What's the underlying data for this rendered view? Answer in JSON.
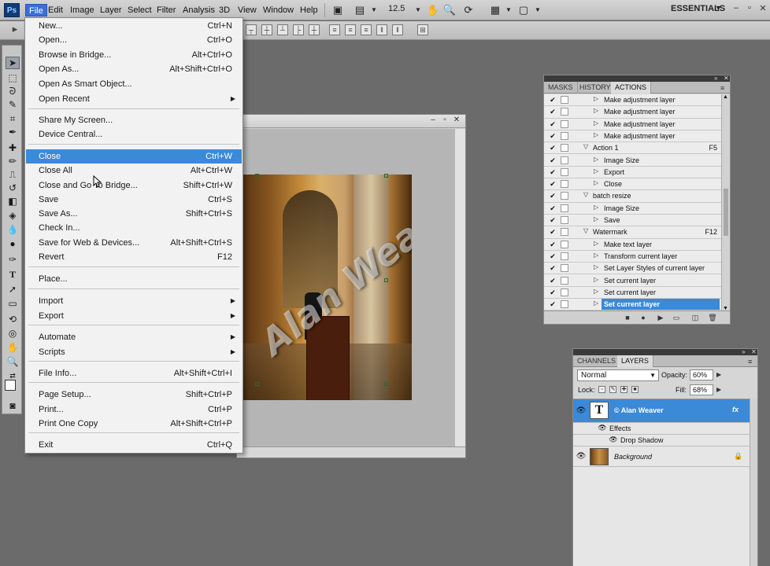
{
  "menubar": {
    "logo": "Ps",
    "items": [
      "File",
      "Edit",
      "Image",
      "Layer",
      "Select",
      "Filter",
      "Analysis",
      "3D",
      "View",
      "Window",
      "Help"
    ],
    "zoom": "12.5",
    "workspace": "ESSENTIALS"
  },
  "file_menu": {
    "items": [
      {
        "label": "New...",
        "shortcut": "Ctrl+N"
      },
      {
        "label": "Open...",
        "shortcut": "Ctrl+O"
      },
      {
        "label": "Browse in Bridge...",
        "shortcut": "Alt+Ctrl+O"
      },
      {
        "label": "Open As...",
        "shortcut": "Alt+Shift+Ctrl+O"
      },
      {
        "label": "Open As Smart Object...",
        "shortcut": ""
      },
      {
        "label": "Open Recent",
        "shortcut": ""
      },
      {
        "label": "Share My Screen...",
        "shortcut": ""
      },
      {
        "label": "Device Central...",
        "shortcut": ""
      },
      {
        "label": "Close",
        "shortcut": "Ctrl+W"
      },
      {
        "label": "Close All",
        "shortcut": "Alt+Ctrl+W"
      },
      {
        "label": "Close and Go To Bridge...",
        "shortcut": "Shift+Ctrl+W"
      },
      {
        "label": "Save",
        "shortcut": "Ctrl+S"
      },
      {
        "label": "Save As...",
        "shortcut": "Shift+Ctrl+S"
      },
      {
        "label": "Check In...",
        "shortcut": ""
      },
      {
        "label": "Save for Web & Devices...",
        "shortcut": "Alt+Shift+Ctrl+S"
      },
      {
        "label": "Revert",
        "shortcut": "F12"
      },
      {
        "label": "Place...",
        "shortcut": ""
      },
      {
        "label": "Import",
        "shortcut": ""
      },
      {
        "label": "Export",
        "shortcut": ""
      },
      {
        "label": "Automate",
        "shortcut": ""
      },
      {
        "label": "Scripts",
        "shortcut": ""
      },
      {
        "label": "File Info...",
        "shortcut": "Alt+Shift+Ctrl+I"
      },
      {
        "label": "Page Setup...",
        "shortcut": "Shift+Ctrl+P"
      },
      {
        "label": "Print...",
        "shortcut": "Ctrl+P"
      },
      {
        "label": "Print One Copy",
        "shortcut": "Alt+Shift+Ctrl+P"
      },
      {
        "label": "Exit",
        "shortcut": "Ctrl+Q"
      }
    ],
    "highlighted": "Close"
  },
  "document": {
    "watermark_text": "Alan Weaver"
  },
  "actions_panel": {
    "tabs": [
      "MASKS",
      "HISTORY",
      "ACTIONS"
    ],
    "active_tab": "ACTIONS",
    "rows": [
      {
        "label": "Make adjustment layer",
        "key": "",
        "kind": "step"
      },
      {
        "label": "Make adjustment layer",
        "key": "",
        "kind": "step"
      },
      {
        "label": "Make adjustment layer",
        "key": "",
        "kind": "step"
      },
      {
        "label": "Make adjustment layer",
        "key": "",
        "kind": "step"
      },
      {
        "label": "Action 1",
        "key": "F5",
        "kind": "action"
      },
      {
        "label": "Image Size",
        "key": "",
        "kind": "step"
      },
      {
        "label": "Export",
        "key": "",
        "kind": "step"
      },
      {
        "label": "Close",
        "key": "",
        "kind": "step"
      },
      {
        "label": "batch resize",
        "key": "",
        "kind": "action"
      },
      {
        "label": "Image Size",
        "key": "",
        "kind": "step"
      },
      {
        "label": "Save",
        "key": "",
        "kind": "step"
      },
      {
        "label": "Watermark",
        "key": "F12",
        "kind": "action"
      },
      {
        "label": "Make text layer",
        "key": "",
        "kind": "step"
      },
      {
        "label": "Transform current layer",
        "key": "",
        "kind": "step"
      },
      {
        "label": "Set Layer Styles of current layer",
        "key": "",
        "kind": "step"
      },
      {
        "label": "Set current layer",
        "key": "",
        "kind": "step"
      },
      {
        "label": "Set current layer",
        "key": "",
        "kind": "step"
      },
      {
        "label": "Set current layer",
        "key": "",
        "kind": "step"
      }
    ],
    "selected_index": 17
  },
  "layers_panel": {
    "tabs": [
      "CHANNELS",
      "LAYERS"
    ],
    "active_tab": "LAYERS",
    "blend_mode": "Normal",
    "opacity_label": "Opacity:",
    "opacity": "60%",
    "lock_label": "Lock:",
    "fill_label": "Fill:",
    "fill": "68%",
    "layers": [
      {
        "name": "© Alan Weaver",
        "type": "text",
        "selected": true
      },
      {
        "name": "Background",
        "type": "image",
        "selected": false
      }
    ],
    "effects_label": "Effects",
    "effect": "Drop Shadow",
    "fx": "fx"
  },
  "colors": {
    "accent": "#3a8ad8",
    "workspace_bg": "#6b6b6b"
  }
}
